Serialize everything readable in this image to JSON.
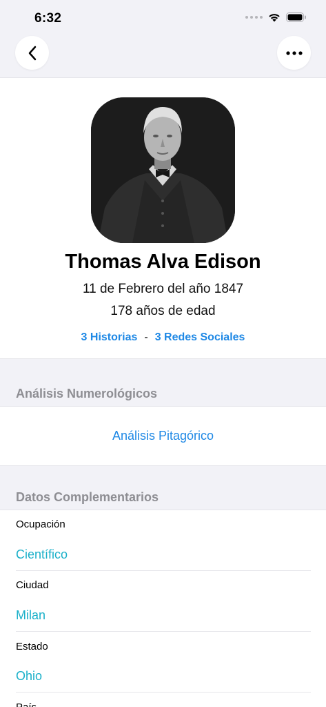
{
  "status_bar": {
    "time": "6:32"
  },
  "nav": {
    "back_icon": "chevron-left-icon",
    "more_icon": "ellipsis-icon"
  },
  "profile": {
    "name": "Thomas Alva Edison",
    "birth_date": "11 de Febrero del año 1847",
    "age": "178 años de edad",
    "stories_link": "3 Historias",
    "separator": "-",
    "social_link": "3 Redes Sociales"
  },
  "numerology": {
    "header": "Análisis Numerológicos",
    "pythagorean_link": "Análisis Pitagórico"
  },
  "complementary": {
    "header": "Datos Complementarios",
    "items": [
      {
        "label": "Ocupación",
        "value": "Científico"
      },
      {
        "label": "Ciudad",
        "value": "Milan"
      },
      {
        "label": "Estado",
        "value": "Ohio"
      },
      {
        "label": "País",
        "value": ""
      }
    ]
  },
  "colors": {
    "accent_blue": "#1e88e5",
    "value_teal": "#1ab0c9",
    "section_gray": "#8e8e93"
  }
}
